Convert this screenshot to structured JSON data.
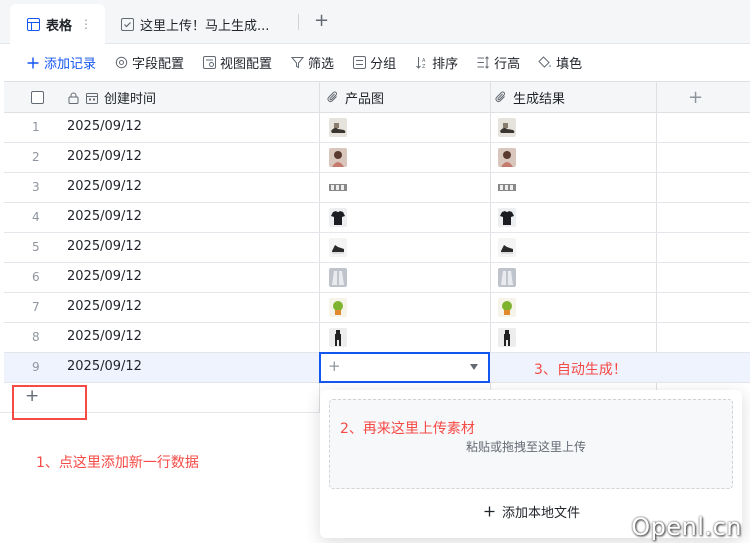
{
  "tabs": {
    "active_label": "表格",
    "active_more": "⋮",
    "second_label": "这里上传！马上生成...",
    "add": "+"
  },
  "toolbar": {
    "add_record": "添加记录",
    "field_config": "字段配置",
    "view_config": "视图配置",
    "filter": "筛选",
    "group": "分组",
    "sort": "排序",
    "row_height": "行高",
    "fill": "填色"
  },
  "table": {
    "columns": [
      "创建时间",
      "产品图",
      "生成结果"
    ],
    "add_column": "+",
    "rows": [
      {
        "num": "1",
        "date": "2025/09/12",
        "product": "shoe",
        "result": "shoe"
      },
      {
        "num": "2",
        "date": "2025/09/12",
        "product": "person",
        "result": "person"
      },
      {
        "num": "3",
        "date": "2025/09/12",
        "product": "strip",
        "result": "strip"
      },
      {
        "num": "4",
        "date": "2025/09/12",
        "product": "shirt",
        "result": "shirt"
      },
      {
        "num": "5",
        "date": "2025/09/12",
        "product": "sneaker",
        "result": "sneaker"
      },
      {
        "num": "6",
        "date": "2025/09/12",
        "product": "jacket",
        "result": "jacket"
      },
      {
        "num": "7",
        "date": "2025/09/12",
        "product": "plant",
        "result": "plant"
      },
      {
        "num": "8",
        "date": "2025/09/12",
        "product": "figure",
        "result": "figure"
      },
      {
        "num": "9",
        "date": "2025/09/12",
        "product": "",
        "result": ""
      }
    ],
    "edit_plus": "+"
  },
  "annotations": {
    "a1": "1、点这里添加新一行数据",
    "a2": "2、再来这里上传素材",
    "a3": "3、自动生成！"
  },
  "upload": {
    "hint": "粘贴或拖拽至这里上传",
    "add_local": "添加本地文件"
  },
  "add_row": "+",
  "watermark": "Openl.cn",
  "colors": {
    "primary": "#1456f0",
    "annotation": "#f54a45",
    "selected_row": "#eef3fe"
  }
}
